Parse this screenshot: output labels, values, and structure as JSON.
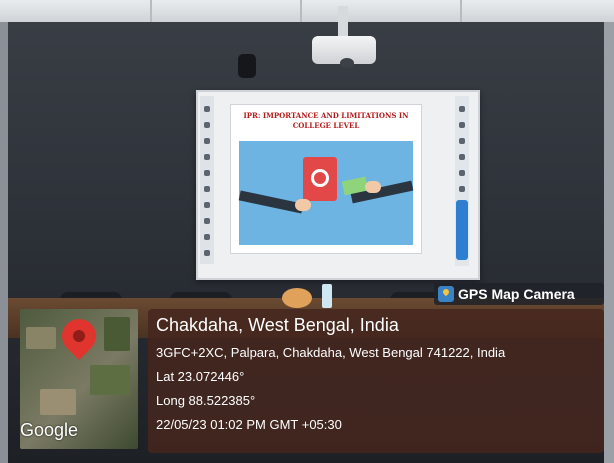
{
  "slide": {
    "title": "IPR: IMPORTANCE AND LIMITATIONS IN COLLEGE LEVEL"
  },
  "badge": {
    "label": "GPS Map Camera",
    "icon": "gps-map-camera-icon"
  },
  "location": {
    "place": "Chakdaha, West Bengal, India",
    "address": "3GFC+2XC, Palpara, Chakdaha, West Bengal 741222, India",
    "lat": "Lat 23.072446°",
    "long": "Long 88.522385°",
    "timestamp": "22/05/23 01:02 PM GMT +05:30"
  },
  "map": {
    "attribution": "Google",
    "pin_icon": "location-pin-icon"
  }
}
